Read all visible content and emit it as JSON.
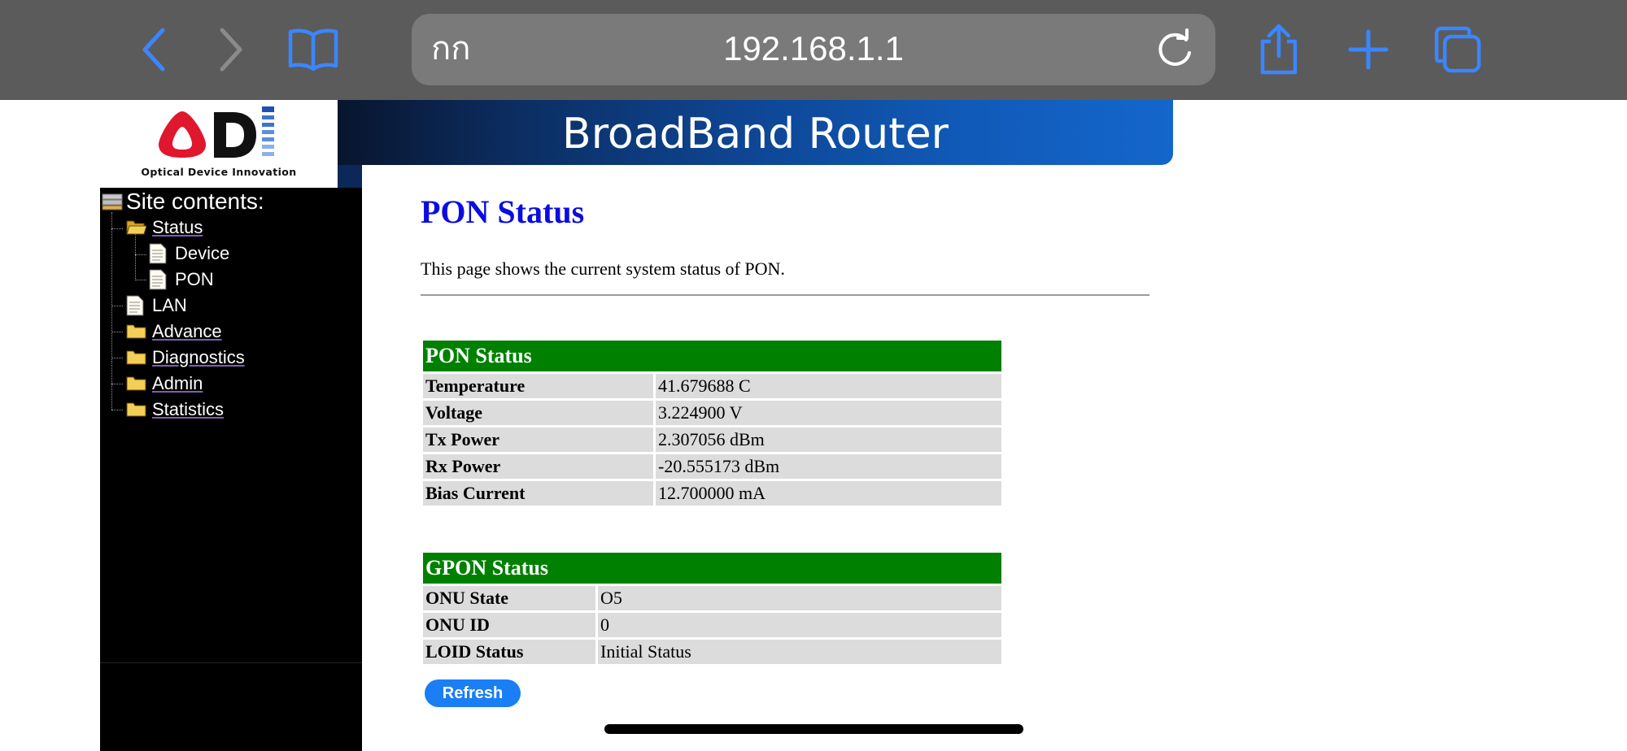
{
  "browser": {
    "text_size_label": "กก",
    "url": "192.168.1.1",
    "accent_color": "#3b86ff",
    "icons": [
      "back-icon",
      "forward-icon",
      "bookmarks-icon",
      "reload-icon",
      "share-icon",
      "new-tab-icon",
      "tabs-icon"
    ]
  },
  "logo": {
    "caption": "Optical Device Innovation"
  },
  "banner": {
    "title": "BroadBand Router"
  },
  "sidebar": {
    "title": "Site contents:",
    "items": [
      {
        "label": "Status",
        "icon": "folder-open-icon",
        "level": 1
      },
      {
        "label": "Device",
        "icon": "page-icon",
        "level": 2
      },
      {
        "label": "PON",
        "icon": "page-icon",
        "level": 2
      },
      {
        "label": "LAN",
        "icon": "page-icon",
        "level": 1
      },
      {
        "label": "Advance",
        "icon": "folder-icon",
        "level": 1
      },
      {
        "label": "Diagnostics",
        "icon": "folder-icon",
        "level": 1
      },
      {
        "label": "Admin",
        "icon": "folder-icon",
        "level": 1
      },
      {
        "label": "Statistics",
        "icon": "folder-icon",
        "level": 1
      }
    ]
  },
  "main": {
    "heading": "PON Status",
    "description": "This page shows the current system status of PON.",
    "pon_table": {
      "title": "PON Status",
      "rows": [
        {
          "label": "Temperature",
          "value": "41.679688 C"
        },
        {
          "label": "Voltage",
          "value": "3.224900 V"
        },
        {
          "label": "Tx Power",
          "value": "2.307056 dBm"
        },
        {
          "label": "Rx Power",
          "value": "-20.555173 dBm"
        },
        {
          "label": "Bias Current",
          "value": "12.700000 mA"
        }
      ]
    },
    "gpon_table": {
      "title": "GPON Status",
      "rows": [
        {
          "label": "ONU State",
          "value": "O5"
        },
        {
          "label": "ONU ID",
          "value": "0"
        },
        {
          "label": "LOID Status",
          "value": "Initial Status"
        }
      ]
    },
    "refresh_label": "Refresh"
  },
  "colors": {
    "table_header": "#008000",
    "heading": "#0c0ce0",
    "refresh_button": "#1a7ef5"
  }
}
